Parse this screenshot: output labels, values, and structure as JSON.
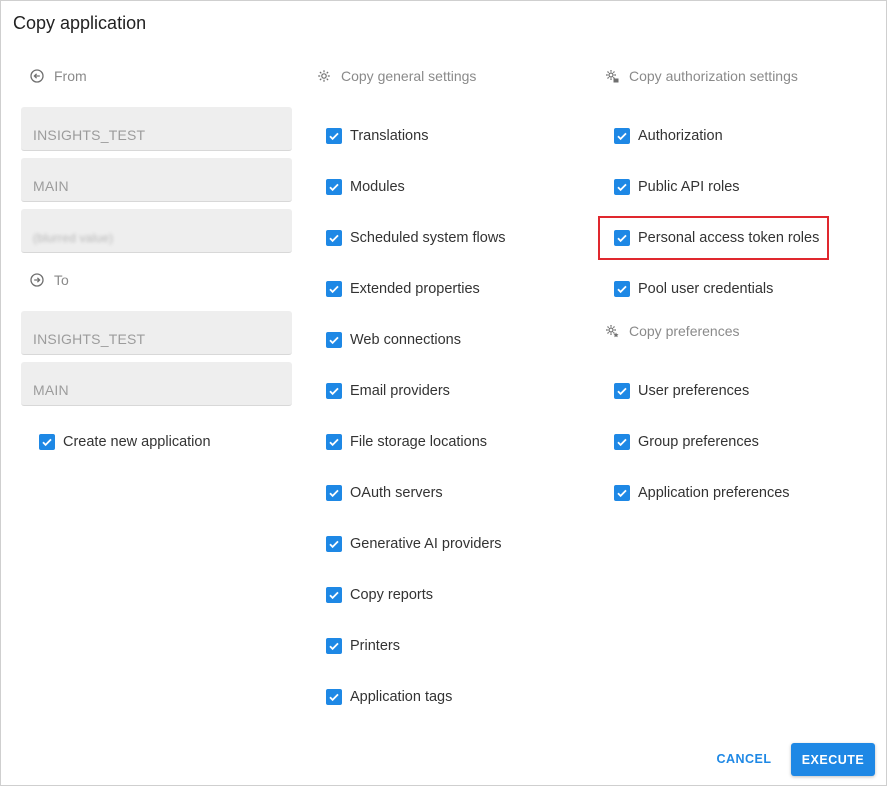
{
  "dialog": {
    "title": "Copy application"
  },
  "from": {
    "label": "From",
    "icon": "arrow-left-circle-icon",
    "fields": [
      "INSIGHTS_TEST",
      "MAIN",
      "(blurred value)"
    ]
  },
  "to": {
    "label": "To",
    "icon": "arrow-right-circle-icon",
    "fields": [
      "INSIGHTS_TEST",
      "MAIN"
    ],
    "create_new": {
      "label": "Create new application",
      "checked": true
    }
  },
  "general": {
    "heading": "Copy general settings",
    "icon": "gear-icon",
    "items": [
      {
        "label": "Translations",
        "checked": true
      },
      {
        "label": "Modules",
        "checked": true
      },
      {
        "label": "Scheduled system flows",
        "checked": true
      },
      {
        "label": "Extended properties",
        "checked": true
      },
      {
        "label": "Web connections",
        "checked": true
      },
      {
        "label": "Email providers",
        "checked": true
      },
      {
        "label": "File storage locations",
        "checked": true
      },
      {
        "label": "OAuth servers",
        "checked": true
      },
      {
        "label": "Generative AI providers",
        "checked": true
      },
      {
        "label": "Copy reports",
        "checked": true
      },
      {
        "label": "Printers",
        "checked": true
      },
      {
        "label": "Application tags",
        "checked": true
      }
    ]
  },
  "authorization": {
    "heading": "Copy authorization settings",
    "icon": "gear-lock-icon",
    "items": [
      {
        "label": "Authorization",
        "checked": true
      },
      {
        "label": "Public API roles",
        "checked": true
      },
      {
        "label": "Personal access token roles",
        "checked": true
      },
      {
        "label": "Pool user credentials",
        "checked": true
      }
    ]
  },
  "preferences": {
    "heading": "Copy preferences",
    "icon": "gear-star-icon",
    "items": [
      {
        "label": "User preferences",
        "checked": true
      },
      {
        "label": "Group preferences",
        "checked": true
      },
      {
        "label": "Application preferences",
        "checked": true
      }
    ]
  },
  "actions": {
    "cancel": "CANCEL",
    "execute": "EXECUTE"
  },
  "colors": {
    "accent": "#1e88e5",
    "highlight": "#e0282e"
  }
}
